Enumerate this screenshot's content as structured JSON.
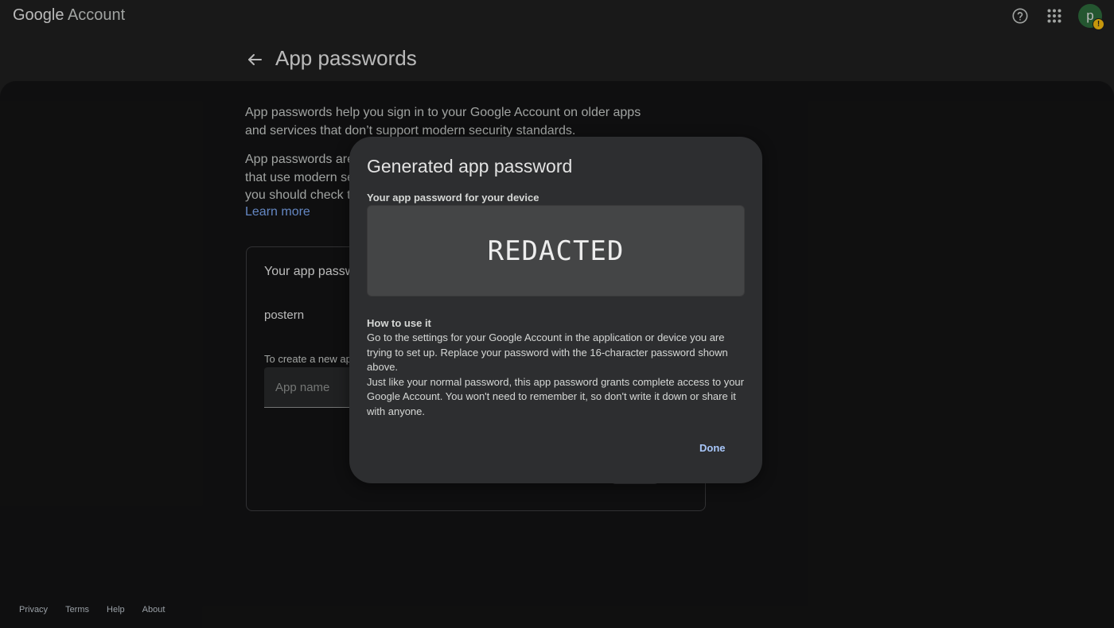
{
  "header": {
    "brand_google": "Google",
    "brand_account": "Account",
    "avatar_letter": "p",
    "avatar_badge": "!"
  },
  "page": {
    "title": "App passwords",
    "intro_1": "App passwords help you sign in to your Google Account on older apps and services that don’t support modern security standards.",
    "intro_2": "App passwords are",
    "intro_2b": "that use modern se",
    "intro_2c": "you should check to",
    "learn_more": "Learn more",
    "box_title": "Your app passw",
    "existing_password_name": "postern",
    "create_hint": "To create a new ap",
    "app_name_placeholder": "App name"
  },
  "dialog": {
    "title": "Generated app password",
    "subtitle": "Your app password for your device",
    "password_value": "REDACTED",
    "howto_title": "How to use it",
    "howto_para1": "Go to the settings for your Google Account in the application or device you are trying to set up. Replace your password with the 16-character password shown above.",
    "howto_para2": "Just like your normal password, this app password grants complete access to your Google Account. You won't need to remember it, so don't write it down or share it with anyone.",
    "done_label": "Done"
  },
  "footer": {
    "privacy": "Privacy",
    "terms": "Terms",
    "help": "Help",
    "about": "About"
  },
  "colors": {
    "background": "#1f1f1f",
    "content_bg": "#131314",
    "dialog_bg": "#2d2e30",
    "link": "#7aa5ee",
    "done": "#a8c7fa",
    "avatar": "#2d6a3b",
    "badge": "#f2b90f"
  },
  "icons": {
    "help": "help-circle-icon",
    "apps": "apps-grid-icon",
    "back": "back-arrow-icon"
  }
}
